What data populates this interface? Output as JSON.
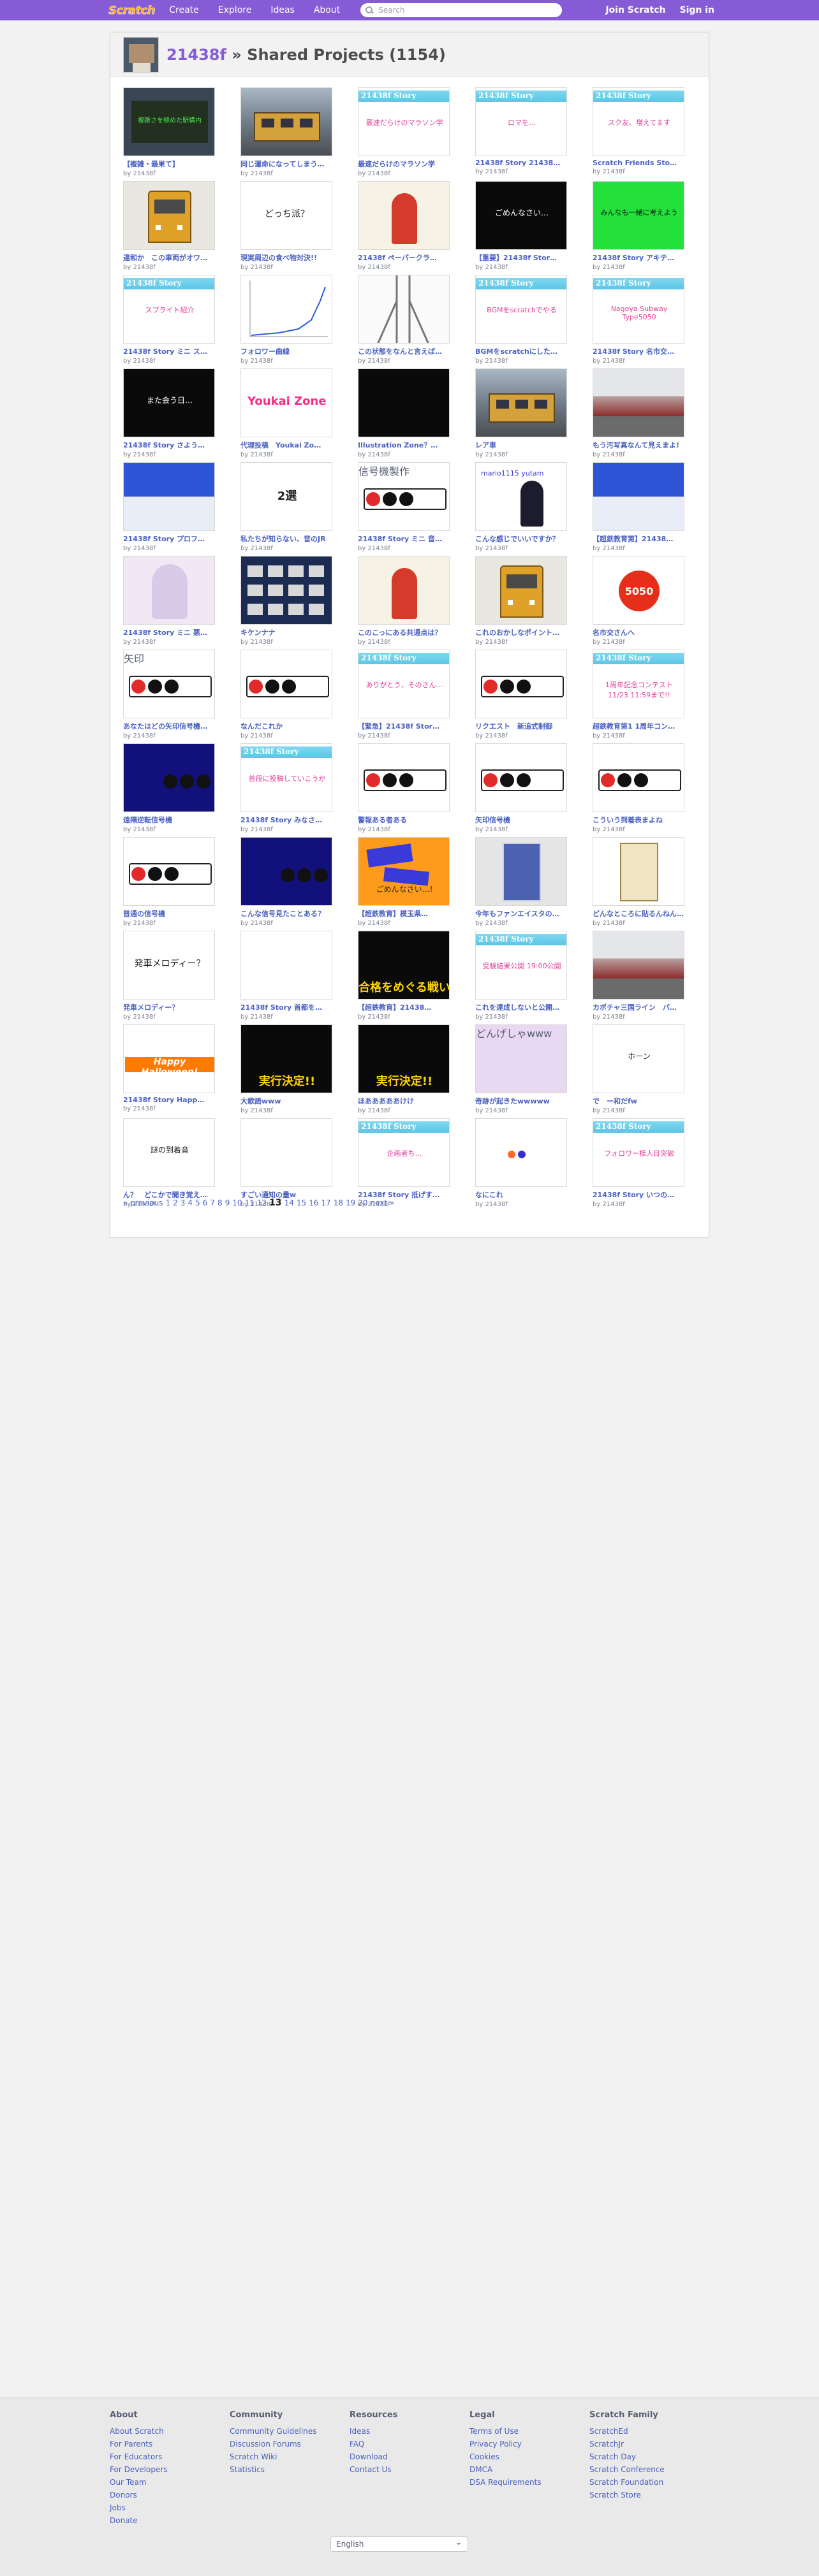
{
  "navbar": {
    "logo": "Scratch",
    "links": [
      "Create",
      "Explore",
      "Ideas",
      "About"
    ],
    "search_placeholder": "Search",
    "join": "Join Scratch",
    "signin": "Sign in"
  },
  "header": {
    "username": "21438f",
    "separator": " » ",
    "title": "Shared Projects (1154)"
  },
  "byline": "by 21438f",
  "projects": [
    {
      "title": "【複雑・最果て】",
      "thumb": "chalk",
      "thumb_text": "複雑さを極めた駅構内"
    },
    {
      "title": "同じ運命になってしまう…",
      "thumb": "photo",
      "thumb_text": ""
    },
    {
      "title": "最速だらけのマラソン学",
      "thumb": "story",
      "thumb_text": "最速だらけのマラソン学"
    },
    {
      "title": "21438f Story 21438…",
      "thumb": "story",
      "thumb_text": "ロマを…"
    },
    {
      "title": "Scratch Friends Sto…",
      "thumb": "story",
      "thumb_text": "スク友、増えてます"
    },
    {
      "title": "違和か　この車両がオワ…",
      "thumb": "yellowtrain",
      "thumb_text": ""
    },
    {
      "title": "現実周辺の食べ物対決!!",
      "thumb": "plain",
      "thumb_text": "どっち派？"
    },
    {
      "title": "21438f ペーパークラ…",
      "thumb": "redgirl",
      "thumb_text": ""
    },
    {
      "title": "【重要】21438f Stor…",
      "thumb": "black",
      "thumb_text": "ごめんなさい…"
    },
    {
      "title": "21438f Story アキテ…",
      "thumb": "green",
      "thumb_text": "みんなも一緒に考えよう"
    },
    {
      "title": "21438f Story ミニ ス…",
      "thumb": "story",
      "thumb_text": "スプライト紹介"
    },
    {
      "title": "フォロワー曲線",
      "thumb": "graph",
      "thumb_text": ""
    },
    {
      "title": "この状態をなんと言えば…",
      "thumb": "rails",
      "thumb_text": ""
    },
    {
      "title": "BGMをscratchにした…",
      "thumb": "story",
      "thumb_text": "BGMをscratchでやる"
    },
    {
      "title": "21438f Story 名市交…",
      "thumb": "story",
      "thumb_text": "Nagoya Subway Type5050"
    },
    {
      "title": "21438f Story さよう…",
      "thumb": "black",
      "thumb_text": "また会う日…"
    },
    {
      "title": "代理投稿　Youkai Zo…",
      "thumb": "pink",
      "thumb_text": "Youkai Zone"
    },
    {
      "title": "Illustration Zone？…",
      "thumb": "black",
      "thumb_text": ""
    },
    {
      "title": "レア車",
      "thumb": "photo",
      "thumb_text": ""
    },
    {
      "title": "もう汚写真なんて見えまよ!",
      "thumb": "station",
      "thumb_text": ""
    },
    {
      "title": "21438f Story プロフ…",
      "thumb": "mixed",
      "thumb_text": ""
    },
    {
      "title": "私たちが知らない、音のJR",
      "thumb": "bigtext",
      "thumb_text": "2選"
    },
    {
      "title": "21438f Story ミニ 音…",
      "thumb": "signal",
      "thumb_text": "信号機製作"
    },
    {
      "title": "こんな感じでいいですか？",
      "thumb": "yuri",
      "thumb_text": "mario1115 yutam"
    },
    {
      "title": "【超鉄教育第】21438…",
      "thumb": "mixed",
      "thumb_text": ""
    },
    {
      "title": "21438f Story ミニ 悪…",
      "thumb": "anime",
      "thumb_text": ""
    },
    {
      "title": "キケンナナ",
      "thumb": "icons",
      "thumb_text": ""
    },
    {
      "title": "このこっにある共通点は？",
      "thumb": "redgirl",
      "thumb_text": ""
    },
    {
      "title": "これのおかしなポイント…",
      "thumb": "yellowtrain",
      "thumb_text": ""
    },
    {
      "title": "名市交さんへ",
      "thumb": "red5050",
      "thumb_text": "5050"
    },
    {
      "title": "あなたはどの矢印信号機…",
      "thumb": "signal",
      "thumb_text": "矢印"
    },
    {
      "title": "なんだこれか",
      "thumb": "signal",
      "thumb_text": ""
    },
    {
      "title": "【緊急】21438f Stor…",
      "thumb": "story",
      "thumb_text": "ありがとう、そのさん…"
    },
    {
      "title": "リクエスト　新追式制御",
      "thumb": "signal",
      "thumb_text": ""
    },
    {
      "title": "超鉄教育第1 1周年コン…",
      "thumb": "story",
      "thumb_text": "1周年記念コンテスト 11/23 11:59まで!!"
    },
    {
      "title": "遠隔逆転信号機",
      "thumb": "navy",
      "thumb_text": ""
    },
    {
      "title": "21438f Story みなさ…",
      "thumb": "story",
      "thumb_text": "普段に投稿していこうか"
    },
    {
      "title": "警報ある者ある",
      "thumb": "signal",
      "thumb_text": ""
    },
    {
      "title": "矢印信号機",
      "thumb": "signal",
      "thumb_text": ""
    },
    {
      "title": "こういう到着表まよね",
      "thumb": "signal",
      "thumb_text": ""
    },
    {
      "title": "普通の信号機",
      "thumb": "signal",
      "thumb_text": ""
    },
    {
      "title": "こんな信号見たことある？",
      "thumb": "navy",
      "thumb_text": ""
    },
    {
      "title": "【超鉄教育】模玉県…",
      "thumb": "orange",
      "thumb_text": "ごめんなさい…!"
    },
    {
      "title": "今年もファンエイスタの…",
      "thumb": "card",
      "thumb_text": ""
    },
    {
      "title": "どんなところに貼るんねん…",
      "thumb": "card2",
      "thumb_text": ""
    },
    {
      "title": "発車メロディー？",
      "thumb": "plain",
      "thumb_text": "発車メロディー？"
    },
    {
      "title": "21438f Story 首都を…",
      "thumb": "white",
      "thumb_text": ""
    },
    {
      "title": "【超鉄教育】21438…",
      "thumb": "blackyellow",
      "thumb_text": "合格をめぐる戦い"
    },
    {
      "title": "これを達成しないと公開…",
      "thumb": "story",
      "thumb_text": "受験結果公開 19:00公開"
    },
    {
      "title": "カポチャ三国ライン　パ…",
      "thumb": "station",
      "thumb_text": ""
    },
    {
      "title": "21438f Story Happ…",
      "thumb": "halloween",
      "thumb_text": "Happy Halloween!"
    },
    {
      "title": "大歌語www",
      "thumb": "blackyellow",
      "thumb_text": "実行決定!!"
    },
    {
      "title": "ほあああああけけ",
      "thumb": "blackyellow",
      "thumb_text": "実行決定!!"
    },
    {
      "title": "奇跡が起きたwwwww",
      "thumb": "purple",
      "thumb_text": "どんげしゃwww"
    },
    {
      "title": "で　ー和だfw",
      "thumb": "gray",
      "thumb_text": "ホーン"
    },
    {
      "title": "ん？　どこかで聞き覚え…",
      "thumb": "gray",
      "thumb_text": "謎の到着音"
    },
    {
      "title": "すごい通知の量w",
      "thumb": "white",
      "thumb_text": ""
    },
    {
      "title": "21438f Story 抵げす…",
      "thumb": "story",
      "thumb_text": "企画者ち…"
    },
    {
      "title": "なにこれ",
      "thumb": "dots",
      "thumb_text": ""
    },
    {
      "title": "21438f Story いつの…",
      "thumb": "story",
      "thumb_text": "フォロワー様人目突破"
    }
  ],
  "pagination": {
    "previous": "« previous",
    "pages": [
      "1",
      "2",
      "3",
      "4",
      "5",
      "6",
      "7",
      "8",
      "9",
      "10",
      "11",
      "12",
      "13",
      "14",
      "15",
      "16",
      "17",
      "18",
      "19",
      "20"
    ],
    "current": "13",
    "next": "next »"
  },
  "footer": {
    "columns": [
      {
        "heading": "About",
        "links": [
          "About Scratch",
          "For Parents",
          "For Educators",
          "For Developers",
          "Our Team",
          "Donors",
          "Jobs",
          "Donate"
        ]
      },
      {
        "heading": "Community",
        "links": [
          "Community Guidelines",
          "Discussion Forums",
          "Scratch Wiki",
          "Statistics"
        ]
      },
      {
        "heading": "Resources",
        "links": [
          "Ideas",
          "FAQ",
          "Download",
          "Contact Us"
        ]
      },
      {
        "heading": "Legal",
        "links": [
          "Terms of Use",
          "Privacy Policy",
          "Cookies",
          "DMCA",
          "DSA Requirements"
        ]
      },
      {
        "heading": "Scratch Family",
        "links": [
          "ScratchEd",
          "ScratchJr",
          "Scratch Day",
          "Scratch Conference",
          "Scratch Foundation",
          "Scratch Store"
        ]
      }
    ],
    "language": "English"
  },
  "colors": {
    "brand": "#855cd6",
    "link": "#4b62c2",
    "logo": "#ffab19"
  }
}
